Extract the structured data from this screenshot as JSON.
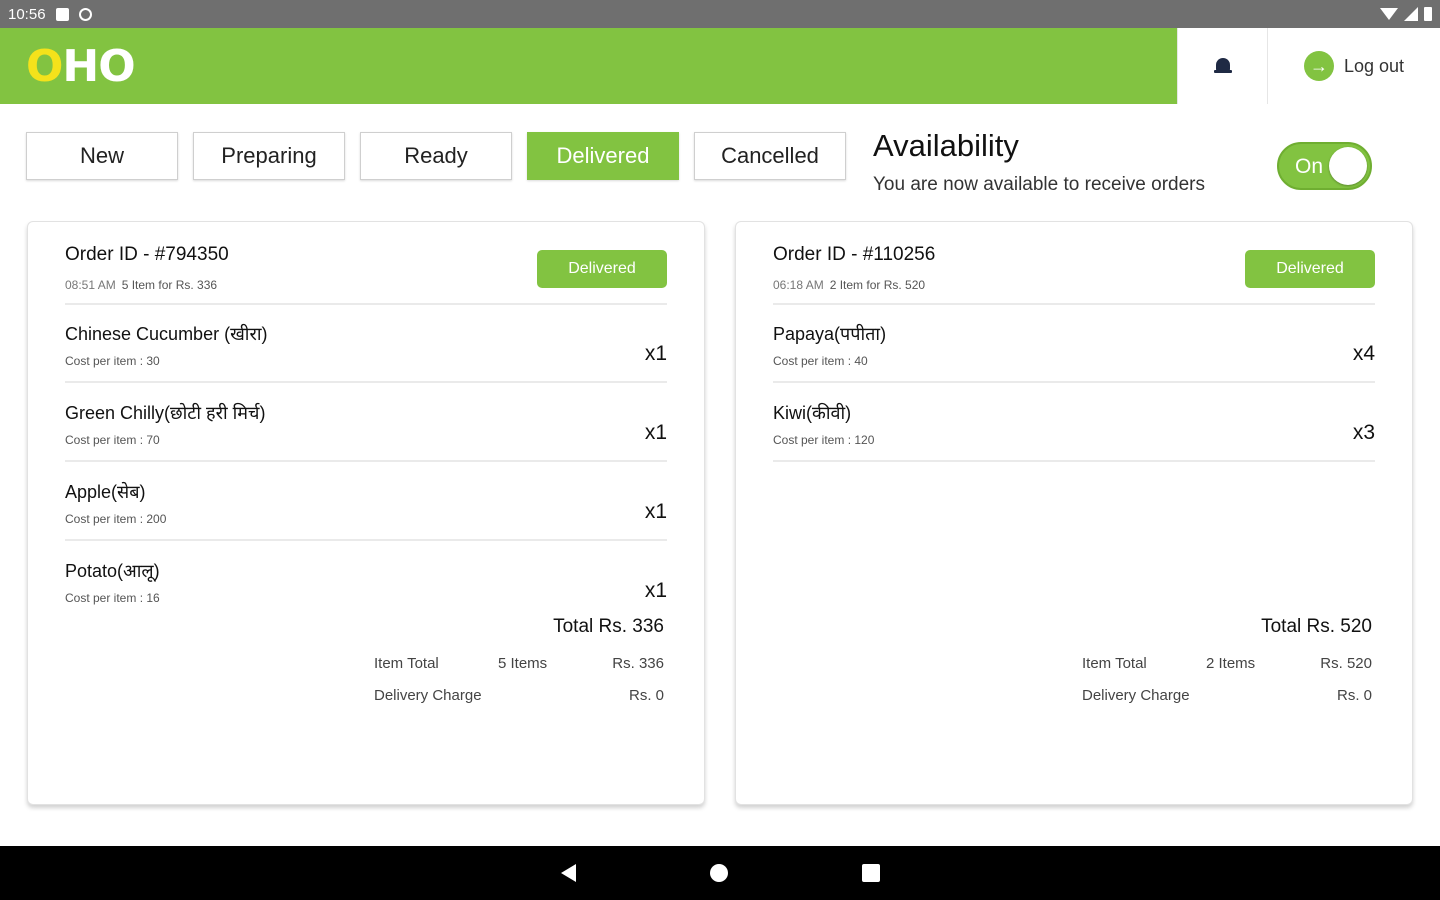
{
  "status_bar": {
    "time": "10:56"
  },
  "header": {
    "logo_first": "O",
    "logo_rest": "HO",
    "logout_label": "Log out"
  },
  "tabs": [
    {
      "label": "New"
    },
    {
      "label": "Preparing"
    },
    {
      "label": "Ready"
    },
    {
      "label": "Delivered",
      "active": true
    },
    {
      "label": "Cancelled"
    }
  ],
  "availability": {
    "title": "Availability",
    "subtitle": "You are now available to receive orders",
    "toggle_label": "On"
  },
  "orders": [
    {
      "order_id": "Order ID - #794350",
      "time": "08:51 AM",
      "summary_line": "5 Item for Rs. 336",
      "status": "Delivered",
      "items": [
        {
          "name": "Chinese Cucumber (खीरा)",
          "cost": "Cost per item : 30",
          "qty": "x1"
        },
        {
          "name": "Green Chilly(छोटी हरी मिर्च)",
          "cost": "Cost per item : 70",
          "qty": "x1"
        },
        {
          "name": "Apple(सेब)",
          "cost": "Cost per item : 200",
          "qty": "x1"
        },
        {
          "name": "Potato(आलू)",
          "cost": "Cost per item : 16",
          "qty": "x1"
        }
      ],
      "total": "Total Rs. 336",
      "item_total_label": "Item Total",
      "item_count": "5 Items",
      "item_total_value": "Rs. 336",
      "delivery_label": "Delivery Charge",
      "delivery_value": "Rs. 0"
    },
    {
      "order_id": "Order ID - #110256",
      "time": "06:18 AM",
      "summary_line": "2 Item for Rs. 520",
      "status": "Delivered",
      "items": [
        {
          "name": "Papaya(पपीता)",
          "cost": "Cost per item : 40",
          "qty": "x4"
        },
        {
          "name": "Kiwi(कीवी)",
          "cost": "Cost per item : 120",
          "qty": "x3"
        }
      ],
      "total": "Total Rs. 520",
      "item_total_label": "Item Total",
      "item_count": "2 Items",
      "item_total_value": "Rs. 520",
      "delivery_label": "Delivery Charge",
      "delivery_value": "Rs. 0"
    }
  ],
  "colors": {
    "brand_green": "#82c341",
    "logo_yellow": "#f4e21b"
  }
}
